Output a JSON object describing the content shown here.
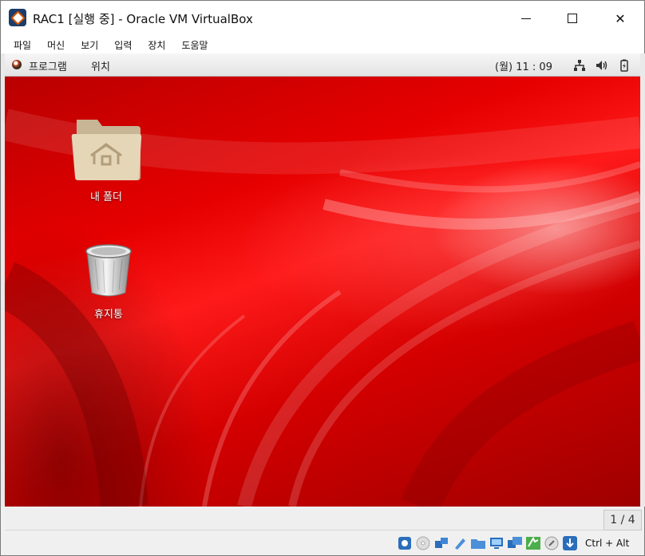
{
  "window": {
    "title": "RAC1 [실행 중] - Oracle VM VirtualBox",
    "controls": {
      "minimize": "",
      "maximize": "",
      "close": "✕"
    }
  },
  "menubar": {
    "items": [
      {
        "label": "파일"
      },
      {
        "label": "머신"
      },
      {
        "label": "보기"
      },
      {
        "label": "입력"
      },
      {
        "label": "장치"
      },
      {
        "label": "도움말"
      }
    ]
  },
  "guest_panel": {
    "applications_label": "프로그램",
    "places_label": "위치",
    "clock": "(월) 11 : 09",
    "tray_icons": [
      "network-icon",
      "volume-icon",
      "battery-icon"
    ]
  },
  "desktop": {
    "icons": [
      {
        "label": "내 폴더",
        "icon": "home-folder-icon"
      },
      {
        "label": "휴지통",
        "icon": "trash-icon"
      }
    ]
  },
  "statusbar": {
    "workspace_indicator": "1 / 4",
    "host_key": "Ctrl + Alt",
    "icons": [
      "hard-disk-icon",
      "optical-drive-icon",
      "network-adapter-icon",
      "usb-icon",
      "shared-folder-icon",
      "display-icon",
      "video-capture-icon",
      "guest-additions-icon",
      "mouse-integration-icon",
      "host-key-arrow-icon"
    ]
  },
  "colors": {
    "desktop_red": "#e60000",
    "accent_blue": "#2a6ebb"
  }
}
